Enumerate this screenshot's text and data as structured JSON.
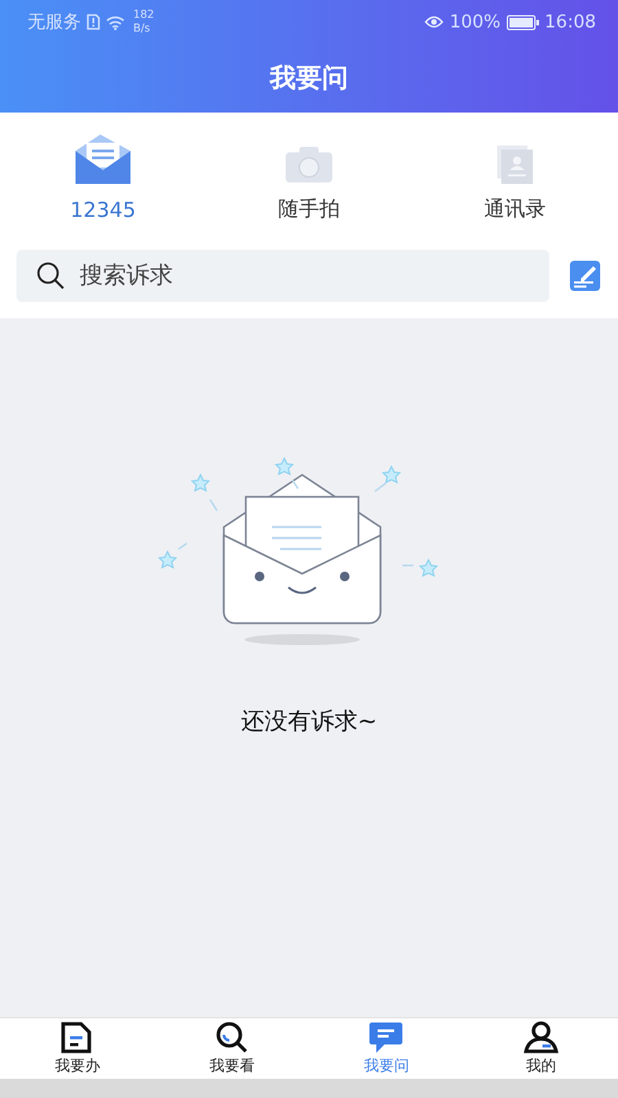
{
  "status_bar": {
    "carrier": "无服务",
    "speed_value": "182",
    "speed_unit": "B/s",
    "battery": "100%",
    "time": "16:08"
  },
  "header": {
    "title": "我要问"
  },
  "shortcuts": [
    {
      "label": "12345",
      "selected": true
    },
    {
      "label": "随手拍",
      "selected": false
    },
    {
      "label": "通讯录",
      "selected": false
    }
  ],
  "search": {
    "placeholder": "搜索诉求"
  },
  "empty_state": {
    "text": "还没有诉求~"
  },
  "tabs": [
    {
      "kind": "todo",
      "label": "我要办",
      "selected": false
    },
    {
      "kind": "view",
      "label": "我要看",
      "selected": false
    },
    {
      "kind": "ask",
      "label": "我要问",
      "selected": true
    },
    {
      "kind": "me",
      "label": "我的",
      "selected": false
    }
  ]
}
